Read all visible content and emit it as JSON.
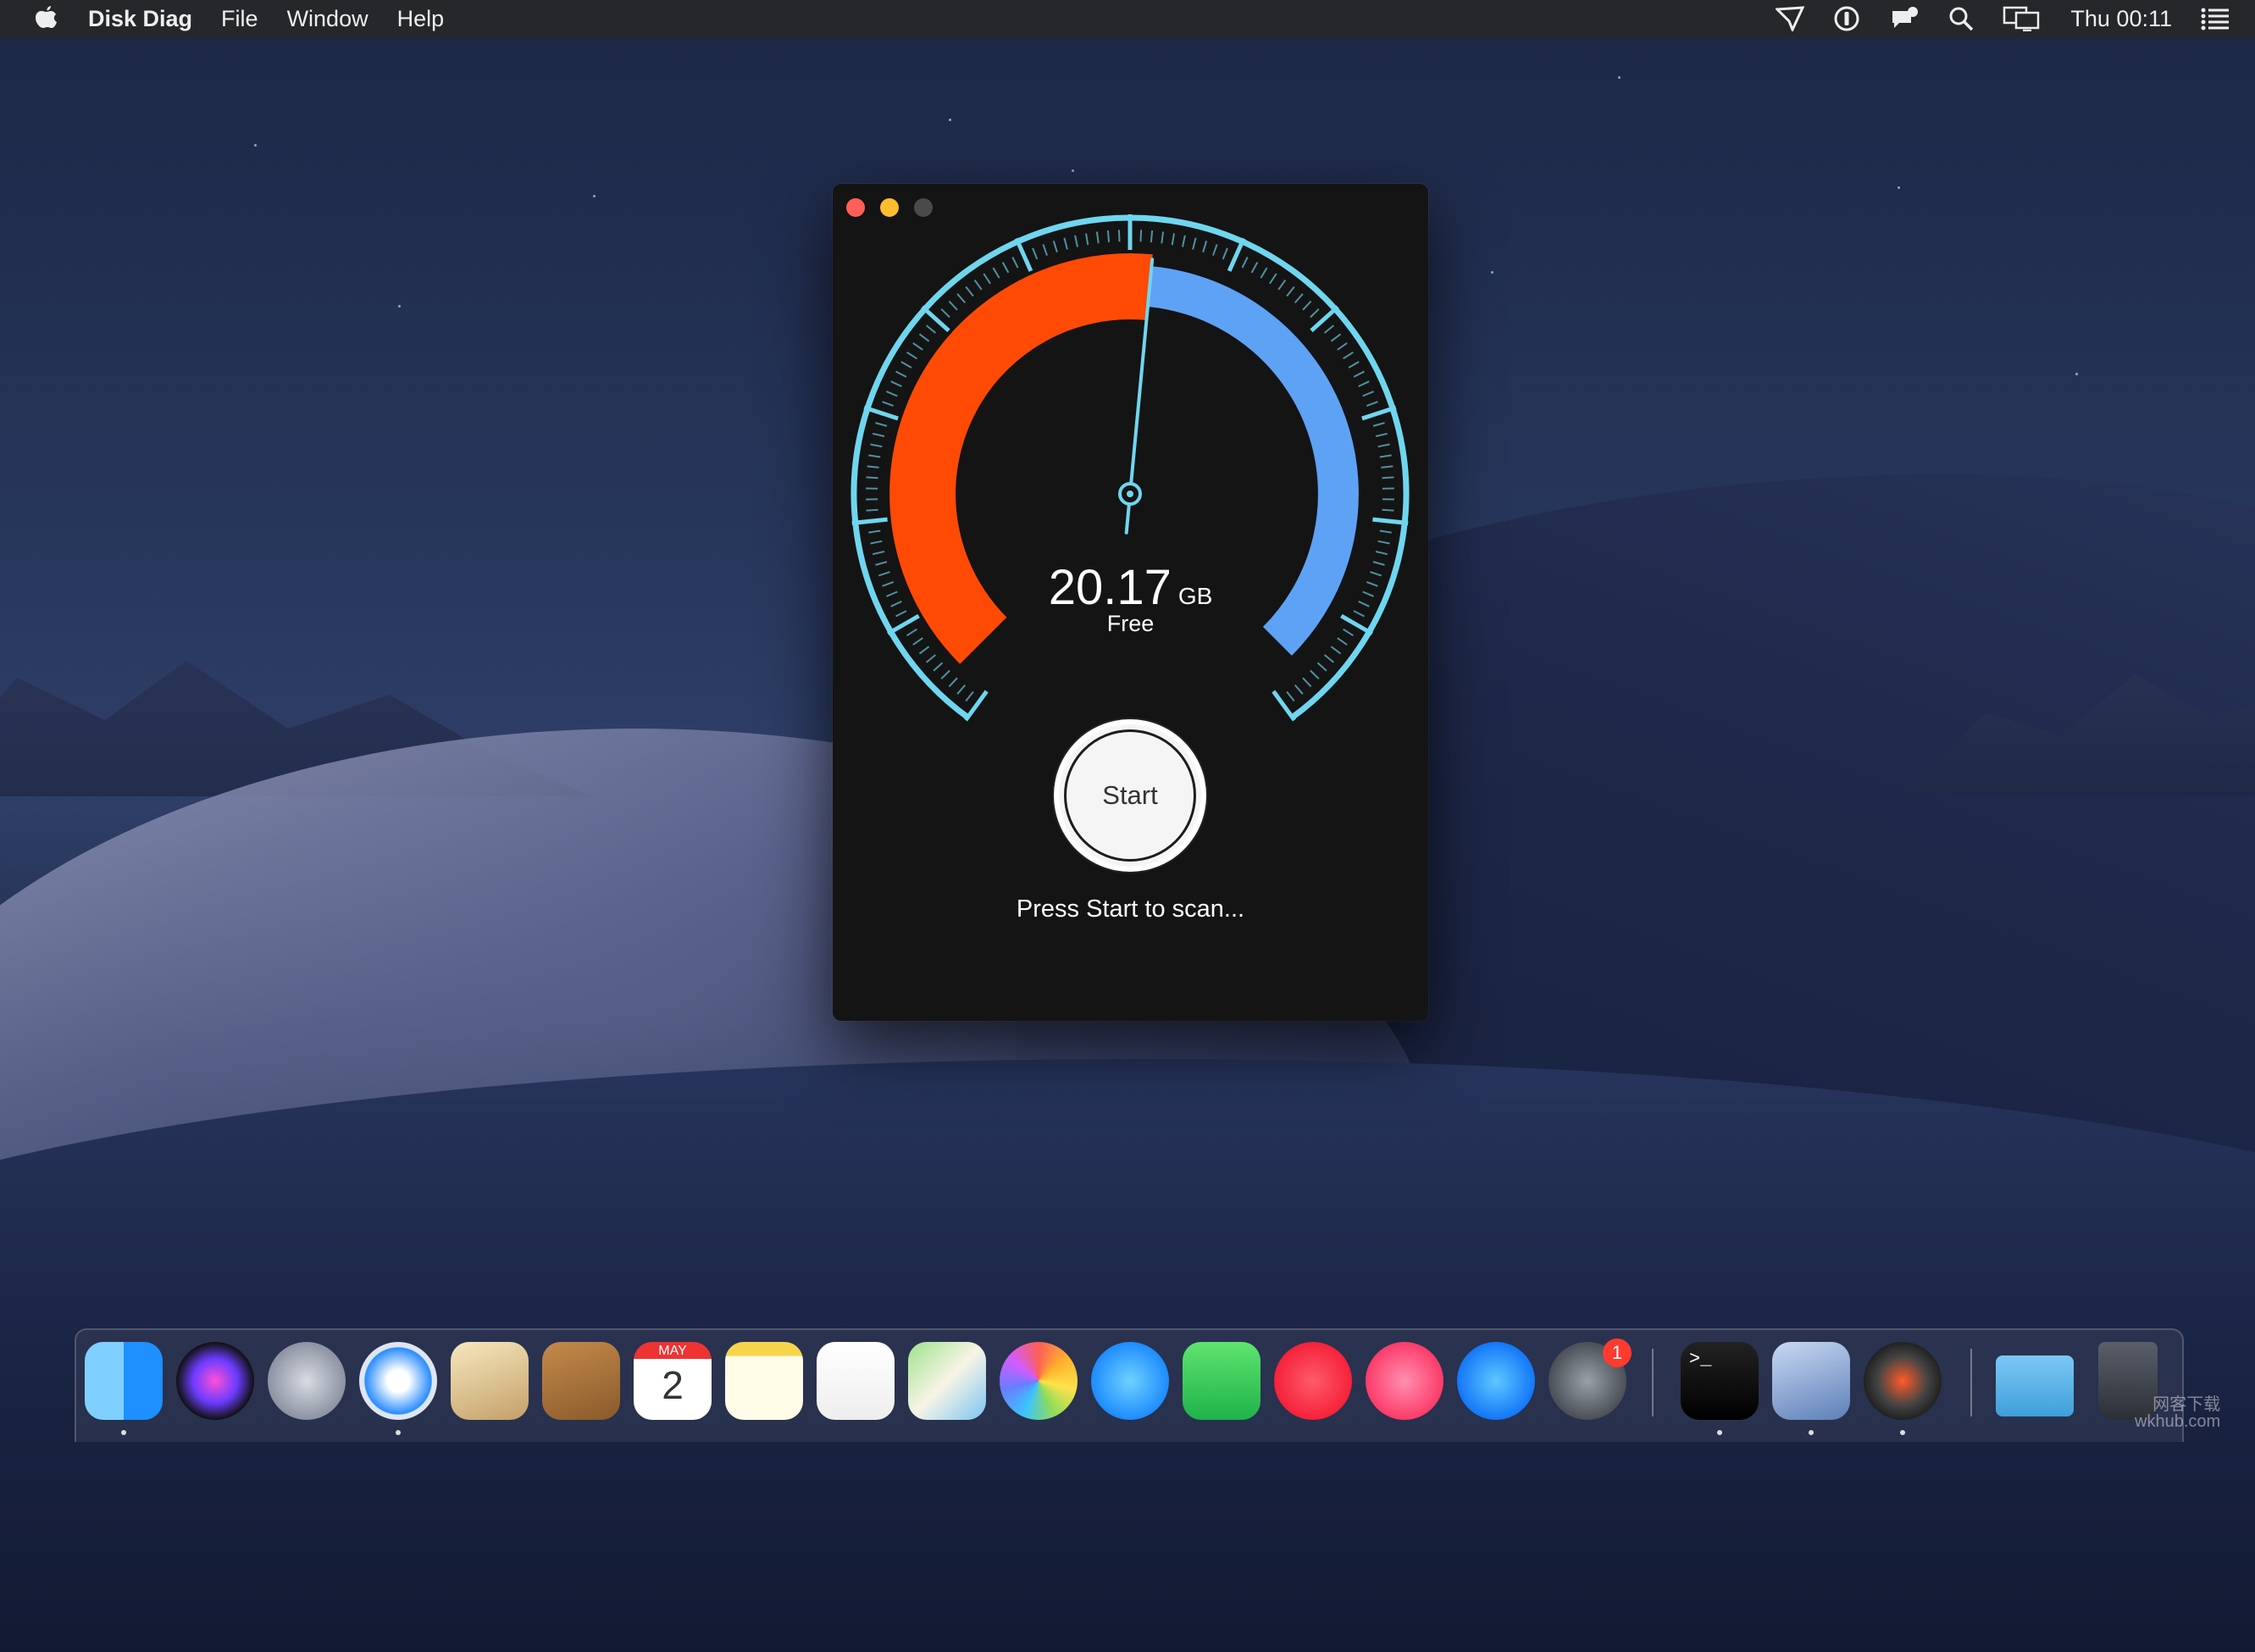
{
  "menubar": {
    "app_name": "Disk Diag",
    "menus": [
      "File",
      "Window",
      "Help"
    ],
    "clock": "Thu 00:11"
  },
  "window": {
    "free_value": "20.17",
    "free_unit": "GB",
    "free_label": "Free",
    "start_label": "Start",
    "status_text": "Press Start to scan...",
    "used_fraction_of_arc": 0.52,
    "colors": {
      "used": "#ff4a06",
      "free": "#5ea2f5",
      "ring": "#6fd6ef"
    }
  },
  "dock": {
    "apps": [
      {
        "name": "finder-icon",
        "running": true
      },
      {
        "name": "siri-icon",
        "running": false
      },
      {
        "name": "launchpad-icon",
        "running": false
      },
      {
        "name": "safari-icon",
        "running": true
      },
      {
        "name": "mail-icon",
        "running": false
      },
      {
        "name": "contacts-icon",
        "running": false
      },
      {
        "name": "calendar-icon",
        "running": false,
        "month": "MAY",
        "day": "2"
      },
      {
        "name": "notes-icon",
        "running": false
      },
      {
        "name": "reminders-icon",
        "running": false
      },
      {
        "name": "maps-icon",
        "running": false
      },
      {
        "name": "photos-icon",
        "running": false
      },
      {
        "name": "messages-icon",
        "running": false
      },
      {
        "name": "facetime-icon",
        "running": false
      },
      {
        "name": "news-icon",
        "running": false
      },
      {
        "name": "music-icon",
        "running": false
      },
      {
        "name": "app-store-icon",
        "running": false
      },
      {
        "name": "system-preferences-icon",
        "running": false,
        "badge": "1"
      },
      {
        "name": "terminal-icon",
        "running": true
      },
      {
        "name": "preview-icon",
        "running": true
      },
      {
        "name": "disk-diag-icon",
        "running": true
      },
      {
        "name": "downloads-folder-icon",
        "running": false
      },
      {
        "name": "trash-icon",
        "running": false
      }
    ]
  },
  "watermark": {
    "line1": "网客下载",
    "line2": "wkhub.com"
  }
}
